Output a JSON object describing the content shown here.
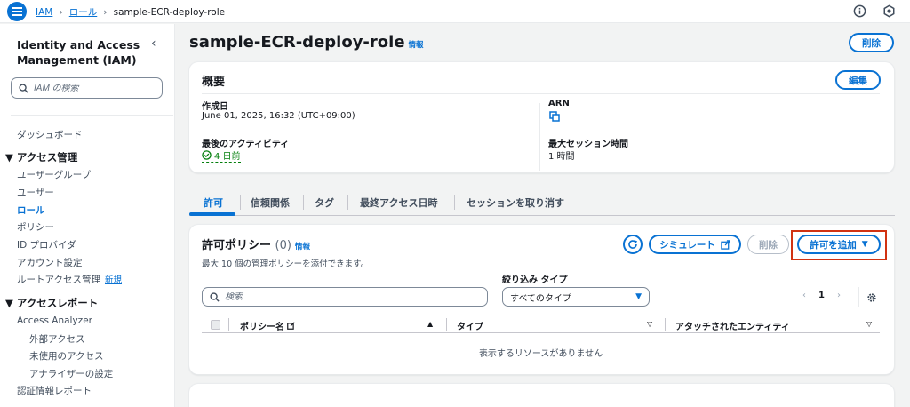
{
  "breadcrumb": [
    "IAM",
    "ロール",
    "sample-ECR-deploy-role"
  ],
  "sidebar": {
    "title": "Identity and Access Management (IAM)",
    "search_placeholder": "IAM の検索",
    "dashboard": "ダッシュボード",
    "access_management": {
      "heading": "アクセス管理",
      "items": [
        "ユーザーグループ",
        "ユーザー",
        "ロール",
        "ポリシー",
        "ID プロバイダ",
        "アカウント設定",
        "ルートアクセス管理"
      ],
      "new_badge": "新規"
    },
    "access_reports": {
      "heading": "アクセスレポート",
      "analyzer": "Access Analyzer",
      "analyzer_items": [
        "外部アクセス",
        "未使用のアクセス",
        "アナライザーの設定"
      ],
      "credential_report": "認証情報レポート"
    }
  },
  "page": {
    "title": "sample-ECR-deploy-role",
    "info": "情報",
    "delete_label": "削除"
  },
  "summary": {
    "title": "概要",
    "edit_label": "編集",
    "created_label": "作成日",
    "created_value": "June 01, 2025, 16:32 (UTC+09:00)",
    "last_activity_label": "最後のアクティビティ",
    "last_activity_value": "4 日前",
    "arn_label": "ARN",
    "max_session_label": "最大セッション時間",
    "max_session_value": "1 時間"
  },
  "tabs": [
    "許可",
    "信頼関係",
    "タグ",
    "最終アクセス日時",
    "セッションを取り消す"
  ],
  "policies": {
    "title": "許可ポリシー",
    "count": "(0)",
    "info": "情報",
    "description": "最大 10 個の管理ポリシーを添付できます。",
    "simulate_label": "シミュレート",
    "remove_label": "削除",
    "add_label": "許可を追加",
    "search_placeholder": "検索",
    "filter_type_label": "絞り込み タイプ",
    "filter_type_value": "すべてのタイプ",
    "page_number": "1",
    "columns": [
      "ポリシー名",
      "タイプ",
      "アタッチされたエンティティ"
    ],
    "empty_message": "表示するリソースがありません"
  },
  "colors": {
    "accent": "#0972d3",
    "success": "#037f0c",
    "highlight": "#d13212"
  }
}
